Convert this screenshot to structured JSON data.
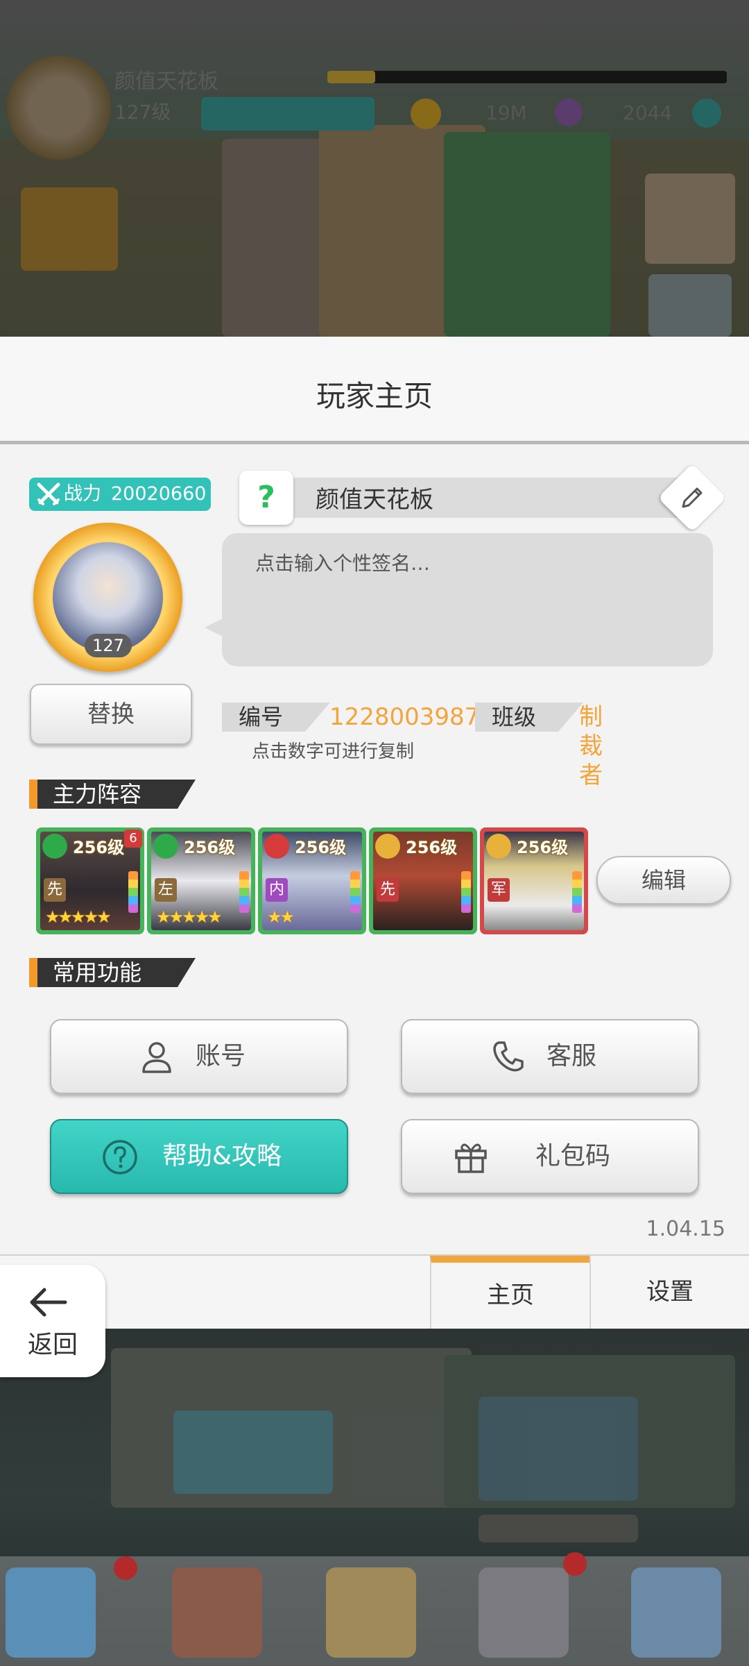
{
  "hud": {
    "player_name": "颜值天花板",
    "level": "127级",
    "coins": "19M",
    "gems": "2044"
  },
  "panel": {
    "title": "玩家主页",
    "power_label": "战力",
    "power_value": "20020660",
    "avatar_level": "127",
    "name_help": "?",
    "player_name": "颜值天花板",
    "signature_placeholder": "点击输入个性签名…",
    "swap_label": "替换",
    "id_label": "编号",
    "id_value": "1228003987",
    "class_label": "班级",
    "class_value": "制裁者",
    "copy_hint": "点击数字可进行复制"
  },
  "lineup": {
    "title": "主力阵容",
    "edit_label": "编辑",
    "heroes": [
      {
        "level": "256级",
        "position": "先",
        "stars": "★★★★★",
        "frame": "green",
        "badge": "6"
      },
      {
        "level": "256级",
        "position": "左",
        "stars": "★★★★★",
        "frame": "green",
        "badge": ""
      },
      {
        "level": "256级",
        "position": "内",
        "stars": "★★",
        "frame": "green",
        "badge": ""
      },
      {
        "level": "256级",
        "position": "先",
        "stars": "",
        "frame": "green",
        "badge": ""
      },
      {
        "level": "256级",
        "position": "军",
        "stars": "",
        "frame": "red",
        "badge": ""
      }
    ]
  },
  "functions": {
    "title": "常用功能",
    "account": "账号",
    "service": "客服",
    "help": "帮助&攻略",
    "gift_code": "礼包码"
  },
  "version": "1.04.15",
  "tabs": {
    "home": "主页",
    "settings": "设置"
  },
  "back": {
    "label": "返回"
  },
  "colors": {
    "accent_teal": "#33c2b7",
    "accent_orange": "#f3a43a"
  }
}
